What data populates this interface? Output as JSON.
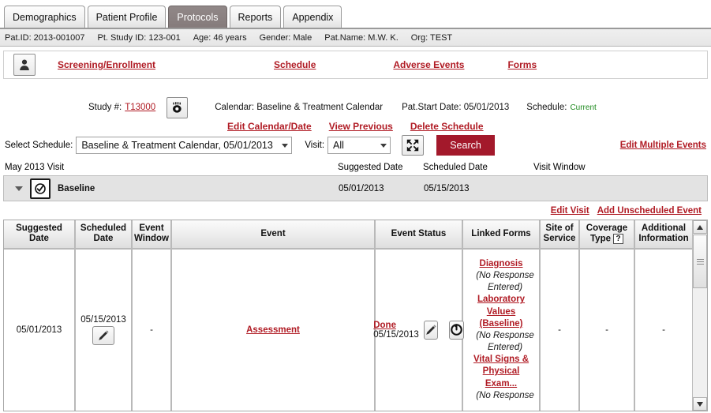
{
  "tabs": [
    {
      "label": "Demographics",
      "active": false
    },
    {
      "label": "Patient Profile",
      "active": false
    },
    {
      "label": "Protocols",
      "active": true
    },
    {
      "label": "Reports",
      "active": false
    },
    {
      "label": "Appendix",
      "active": false
    }
  ],
  "patient_bar": {
    "pat_id": "Pat.ID: 2013-001007",
    "study_id": "Pt. Study ID: 123-001",
    "age": "Age: 46 years",
    "gender": "Gender: Male",
    "name": "Pat.Name: M.W. K.",
    "org": "Org: TEST"
  },
  "nav": {
    "person_icon": "person-icon",
    "links": [
      "Screening/Enrollment",
      "Schedule",
      "Adverse Events",
      "Forms"
    ]
  },
  "study_header": {
    "study_label": "Study #:",
    "study_number": "T13000",
    "eye_icon": "eye-icon",
    "calendar": "Calendar: Baseline & Treatment Calendar",
    "pat_start_date": "Pat.Start Date: 05/01/2013",
    "schedule_label": "Schedule:",
    "schedule_status": "Current",
    "actions": [
      "Edit Calendar/Date",
      "View Previous",
      "Delete Schedule"
    ]
  },
  "select_row": {
    "schedule_label": "Select Schedule:",
    "schedule_value": "Baseline & Treatment Calendar, 05/01/2013",
    "visit_label": "Visit:",
    "visit_value": "All",
    "expand_icon": "expand-icon",
    "search_label": "Search",
    "edit_multiple": "Edit Multiple Events",
    "accent": "#a3192b"
  },
  "visit_header": {
    "month_visit": "May 2013 Visit",
    "suggested_date": "Suggested Date",
    "scheduled_date": "Scheduled Date",
    "visit_window": "Visit Window"
  },
  "baseline": {
    "name": "Baseline",
    "suggested_date": "05/01/2013",
    "scheduled_date": "05/15/2013",
    "check_icon": "checkmark-icon",
    "toggle_icon": "triangle-down-icon"
  },
  "edit_links": {
    "edit_visit": "Edit Visit",
    "add_unscheduled": "Add Unscheduled Event"
  },
  "grid": {
    "headers": [
      "Suggested Date",
      "Scheduled Date",
      "Event Window",
      "Event",
      "Event Status",
      "Linked Forms",
      "Site of Service",
      "Coverage Type",
      "Additional Information"
    ],
    "coverage_help_badge": "?",
    "rows": [
      {
        "suggested_date": "05/01/2013",
        "scheduled_date": "05/15/2013",
        "scheduled_edit_icon": "pencil-icon",
        "event_window": "-",
        "event": "Assessment",
        "status_label": "Done",
        "status_date": "05/15/2013",
        "status_edit_icon": "pencil-icon",
        "status_undo_icon": "undo-icon",
        "linked_forms": [
          {
            "name": "Diagnosis",
            "response": "(No Response Entered)"
          },
          {
            "name": "Laboratory Values (Baseline)",
            "response": "(No Response Entered)"
          },
          {
            "name": "Vital Signs & Physical Exam...",
            "response": "(No Response"
          }
        ],
        "site_of_service": "-",
        "coverage_type": "-",
        "additional_information": "-"
      }
    ]
  },
  "scrollbar": {
    "up_arrow": "caret-up-icon",
    "down_arrow": "caret-down-icon",
    "thumb": "scroll-thumb"
  }
}
